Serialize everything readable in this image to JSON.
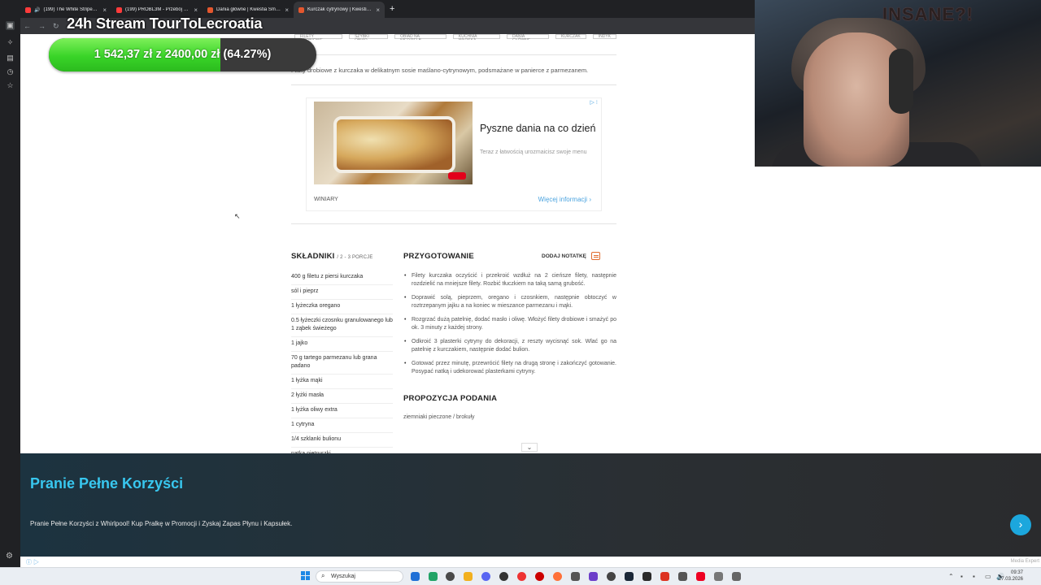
{
  "browser": {
    "tabs": [
      {
        "title": "(199) The White Stripes - Se",
        "color": "#ff3b3b"
      },
      {
        "title": "(199) PROBL3M - Przebój nocy",
        "color": "#ff3b3b"
      },
      {
        "title": "Dania główne | Kwestia Smaku",
        "color": "#e4572e"
      },
      {
        "title": "Kurczak cytrynowy | Kwestia Sm",
        "color": "#e4572e"
      }
    ],
    "new_tab": "+"
  },
  "stream": {
    "title": "24h Stream TourToLecroatia",
    "progress_label": "1 542,37 zł z 2400,00 zł (64.27%)",
    "progress_fraction": 0.6427,
    "neon_text": "INSANE?!"
  },
  "recipe": {
    "tags": [
      "FILETY DROBIOWE",
      "SZYBKI OBIAD",
      "OBIAD NA NIEDZIELĘ",
      "KUCHNIA WŁOSKA",
      "DANIA GŁÓWNE",
      "KURCZAK",
      "INDYK"
    ],
    "description": "Filety drobiowe z kurczaka w delikatnym sosie maślano-cytrynowym, podsmażane w panierce z parmezanem.",
    "ingredients_heading": "SKŁADNIKI",
    "portions": "2 - 3 PORCJE",
    "ingredients": [
      "400 g filetu z piersi kurczaka",
      "sól i pieprz",
      "1 łyżeczka oregano",
      "0.5 łyżeczki czosnku granulowanego lub 1 ząbek świeżego",
      "1 jajko",
      "70 g tartego parmezanu lub grana padano",
      "1 łyżka mąki",
      "2 łyżki masła",
      "1 łyżka oliwy extra",
      "1 cytryna",
      "1/4 szklanki bulionu",
      "natka pietruszki"
    ],
    "prep_heading": "PRZYGOTOWANIE",
    "add_note": "DODAJ NOTATKĘ",
    "steps": [
      "Filety kurczaka oczyścić i przekroić wzdłuż na 2 cieńsze filety, następnie rozdzielić na mniejsze filety. Rozbić tłuczkiem na taką samą grubość.",
      "Doprawić solą, pieprzem, oregano i czosnkiem, następnie obtoczyć w roztrzepanym jajku a na koniec w mieszance parmezanu i mąki.",
      "Rozgrzać dużą patelnię, dodać masło i oliwę. Włożyć filety drobiowe i smażyć po ok. 3 minuty z każdej strony.",
      "Odkroić 3 plasterki cytryny do dekoracji, z reszty wycisnąć sok. Wlać go na patelnię z kurczakiem, następnie dodać bulion.",
      "Gotować przez minutę, przewrócić filety na drugą stronę i zakończyć gotowanie. Posypać natką i udekorować plasterkami cytryny."
    ],
    "serving_heading": "PROPOZYCJA PODANIA",
    "serving": "ziemniaki pieczone / brokuły"
  },
  "ad": {
    "title": "Pyszne dania na co dzień",
    "subtitle": "Teraz z łatwością urozmaicisz swoje menu",
    "brand": "WINIARY",
    "more": "Więcej informacji"
  },
  "banner": {
    "title": "Pranie Pełne Korzyści",
    "text": "Pranie Pełne Korzyści z Whirlpool! Kup Pralkę w Promocji i Zyskaj Zapas Płynu i Kapsułek."
  },
  "taskbar": {
    "search_placeholder": "Wyszukaj",
    "time": "09:37",
    "date": "27.03.2026",
    "media": "Media Expert"
  }
}
